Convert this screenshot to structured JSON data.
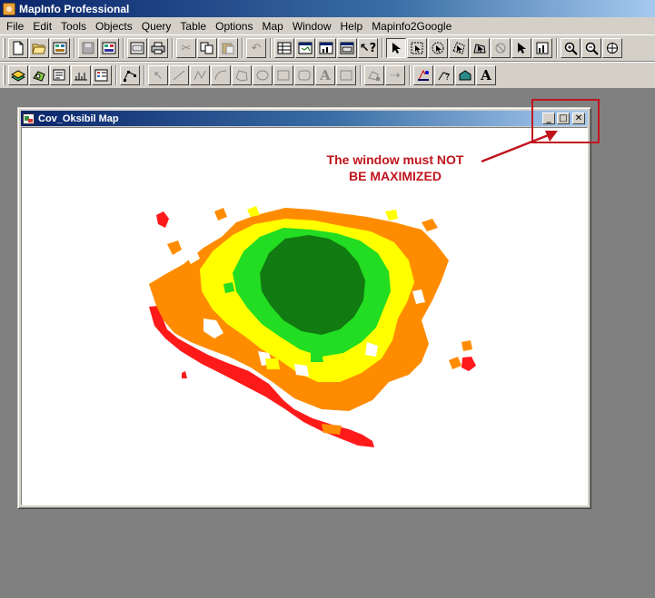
{
  "app": {
    "title": "MapInfo Professional",
    "icon": "mapinfo-app-icon"
  },
  "menu": [
    "File",
    "Edit",
    "Tools",
    "Objects",
    "Query",
    "Table",
    "Options",
    "Map",
    "Window",
    "Help",
    "Mapinfo2Google"
  ],
  "toolbar_main": {
    "icons": [
      "new-icon",
      "open-icon",
      "open-workspace-icon",
      "save-icon",
      "save-workspace-icon",
      "save-copy-icon",
      "print-icon",
      "cut-icon",
      "copy-icon",
      "paste-icon",
      "undo-icon",
      "new-browser-icon",
      "new-mapper-icon",
      "new-grapher-icon",
      "new-layout-icon",
      "help-icon",
      "select-arrow-icon",
      "marquee-select-icon",
      "radius-select-icon",
      "polygon-select-icon",
      "boundary-select-icon",
      "unselect-all-icon",
      "invert-selection-icon",
      "graph-select-icon",
      "zoom-in-icon",
      "zoom-out-icon",
      "change-view-icon"
    ]
  },
  "toolbar_draw": {
    "icons": [
      "layer-control-icon",
      "label-icon",
      "info-tool-icon",
      "ruler-icon",
      "legend-icon",
      "reshape-icon",
      "symbol-icon",
      "line-icon",
      "polyline-icon",
      "arc-icon",
      "polygon-icon",
      "ellipse-icon",
      "rectangle-icon",
      "rounded-rectangle-icon",
      "text-icon",
      "frame-icon",
      "add-node-icon",
      "line-style-icon",
      "region-style-icon",
      "symbol-style-icon",
      "text-style-icon"
    ],
    "glyphs": {
      "text": "A",
      "text_style": "A"
    }
  },
  "map_window": {
    "title": "Cov_Oksibil Map",
    "controls": {
      "minimize": "_",
      "maximize": "□",
      "close": "✕"
    }
  },
  "annotation": {
    "line1": "The window must NOT",
    "line2": "BE MAXIMIZED",
    "color": "#c0141c"
  },
  "map_legend_colors": {
    "dark_green": "#117a11",
    "green": "#22dd22",
    "yellow": "#ffff00",
    "orange": "#ff8c00",
    "red": "#ff1a1a"
  },
  "colors": {
    "workspace": "#808080",
    "title_active": "#0a246a",
    "face": "#d4d0c8"
  }
}
